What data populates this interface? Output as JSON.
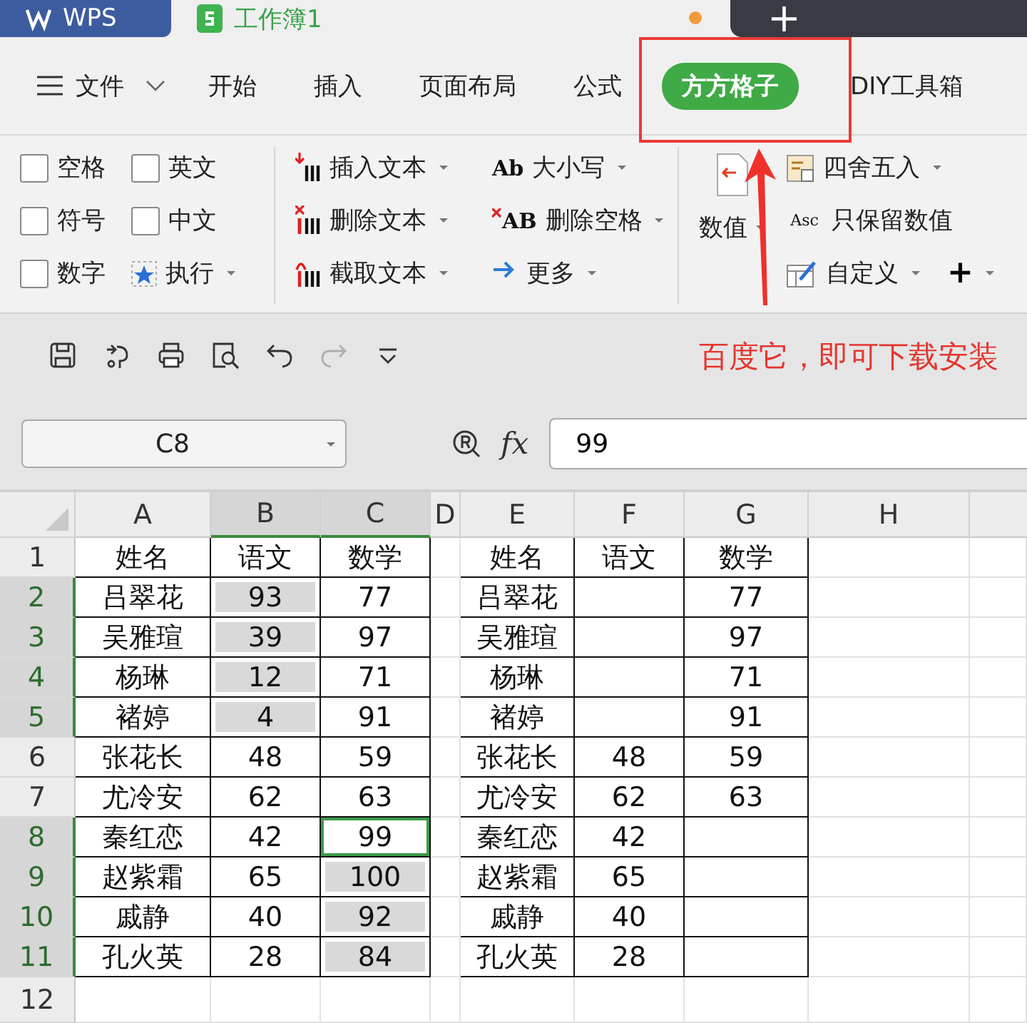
{
  "title_bar": {
    "tabs": [
      {
        "kind": "app",
        "label": "WPS",
        "modified": false
      },
      {
        "kind": "document",
        "label": "工作簿1",
        "modified": true
      }
    ],
    "new_tab": "+"
  },
  "menu": {
    "file": "文件",
    "tabs": [
      {
        "label": "开始",
        "selected": false
      },
      {
        "label": "插入",
        "selected": false
      },
      {
        "label": "页面布局",
        "selected": false
      },
      {
        "label": "公式",
        "selected": false
      },
      {
        "label": "方方格子",
        "selected": true
      },
      {
        "label": "DIY工具箱",
        "selected": false
      }
    ]
  },
  "ribbon": {
    "options": [
      {
        "label": "空格",
        "checked": false
      },
      {
        "label": "英文",
        "checked": false
      },
      {
        "label": "符号",
        "checked": false
      },
      {
        "label": "中文",
        "checked": false
      },
      {
        "label": "数字",
        "checked": false
      }
    ],
    "execute": {
      "label": "执行",
      "dropdown": true
    },
    "text_commands": [
      {
        "kind": "insert",
        "label": "插入文本",
        "dropdown": true
      },
      {
        "kind": "case",
        "glyph": "Ab",
        "label": "大小写",
        "dropdown": true
      },
      {
        "kind": "delete",
        "label": "删除文本",
        "dropdown": true
      },
      {
        "kind": "delete_spaces",
        "glyph": "AB",
        "label": "删除空格",
        "dropdown": true
      },
      {
        "kind": "extract",
        "label": "截取文本",
        "dropdown": true
      },
      {
        "kind": "more",
        "label": "更多",
        "dropdown": true
      }
    ],
    "numbers": {
      "label": "数值",
      "dropdown": true
    },
    "number_commands": [
      {
        "kind": "round",
        "label": "四舍五入",
        "dropdown": true
      },
      {
        "kind": "keep",
        "glyph": "Asc",
        "label": "只保留数值",
        "dropdown": false
      },
      {
        "kind": "custom",
        "label": "自定义",
        "dropdown": true
      }
    ],
    "add": {
      "label": "+",
      "dropdown": true
    }
  },
  "quick_access": [
    {
      "kind": "save",
      "disabled": false
    },
    {
      "kind": "painter",
      "disabled": false
    },
    {
      "kind": "print",
      "disabled": false
    },
    {
      "kind": "preview",
      "disabled": false
    },
    {
      "kind": "undo",
      "disabled": false
    },
    {
      "kind": "redo",
      "disabled": true
    },
    {
      "kind": "customize",
      "disabled": false
    }
  ],
  "annotation": {
    "text": "百度它，即可下载安装"
  },
  "formula_bar": {
    "name_box": "C8",
    "fx": "fx",
    "value": "99"
  },
  "sheet": {
    "columns": [
      {
        "label": "A",
        "selected": false,
        "bordered": true
      },
      {
        "label": "B",
        "selected": true,
        "bordered": true
      },
      {
        "label": "C",
        "selected": true,
        "bordered": true
      },
      {
        "label": "D",
        "selected": false,
        "bordered": false
      },
      {
        "label": "E",
        "selected": false,
        "bordered": true
      },
      {
        "label": "F",
        "selected": false,
        "bordered": true
      },
      {
        "label": "G",
        "selected": false,
        "bordered": true
      },
      {
        "label": "H",
        "selected": false,
        "bordered": false
      }
    ],
    "rows": [
      {
        "number": "1",
        "selected": false,
        "bordered": true,
        "cells": [
          {
            "value": "姓名",
            "selected": false,
            "active": false
          },
          {
            "value": "语文",
            "selected": false,
            "active": false
          },
          {
            "value": "数学",
            "selected": false,
            "active": false
          },
          {
            "selected": false,
            "active": false
          },
          {
            "value": "姓名",
            "selected": false,
            "active": false
          },
          {
            "value": "语文",
            "selected": false,
            "active": false
          },
          {
            "value": "数学",
            "selected": false,
            "active": false
          },
          {
            "selected": false,
            "active": false
          }
        ]
      },
      {
        "number": "2",
        "selected": true,
        "bordered": true,
        "cells": [
          {
            "value": "吕翠花",
            "selected": false,
            "active": false
          },
          {
            "value": "93",
            "selected": true,
            "active": false
          },
          {
            "value": "77",
            "selected": false,
            "active": false
          },
          {
            "selected": false,
            "active": false
          },
          {
            "value": "吕翠花",
            "selected": false,
            "active": false
          },
          {
            "selected": false,
            "active": false
          },
          {
            "value": "77",
            "selected": false,
            "active": false
          },
          {
            "selected": false,
            "active": false
          }
        ]
      },
      {
        "number": "3",
        "selected": true,
        "bordered": true,
        "cells": [
          {
            "value": "吴雅瑄",
            "selected": false,
            "active": false
          },
          {
            "value": "39",
            "selected": true,
            "active": false
          },
          {
            "value": "97",
            "selected": false,
            "active": false
          },
          {
            "selected": false,
            "active": false
          },
          {
            "value": "吴雅瑄",
            "selected": false,
            "active": false
          },
          {
            "selected": false,
            "active": false
          },
          {
            "value": "97",
            "selected": false,
            "active": false
          },
          {
            "selected": false,
            "active": false
          }
        ]
      },
      {
        "number": "4",
        "selected": true,
        "bordered": true,
        "cells": [
          {
            "value": "杨琳",
            "selected": false,
            "active": false
          },
          {
            "value": "12",
            "selected": true,
            "active": false
          },
          {
            "value": "71",
            "selected": false,
            "active": false
          },
          {
            "selected": false,
            "active": false
          },
          {
            "value": "杨琳",
            "selected": false,
            "active": false
          },
          {
            "selected": false,
            "active": false
          },
          {
            "value": "71",
            "selected": false,
            "active": false
          },
          {
            "selected": false,
            "active": false
          }
        ]
      },
      {
        "number": "5",
        "selected": true,
        "bordered": true,
        "cells": [
          {
            "value": "褚婷",
            "selected": false,
            "active": false
          },
          {
            "value": "4",
            "selected": true,
            "active": false
          },
          {
            "value": "91",
            "selected": false,
            "active": false
          },
          {
            "selected": false,
            "active": false
          },
          {
            "value": "褚婷",
            "selected": false,
            "active": false
          },
          {
            "selected": false,
            "active": false
          },
          {
            "value": "91",
            "selected": false,
            "active": false
          },
          {
            "selected": false,
            "active": false
          }
        ]
      },
      {
        "number": "6",
        "selected": false,
        "bordered": true,
        "cells": [
          {
            "value": "张花长",
            "selected": false,
            "active": false
          },
          {
            "value": "48",
            "selected": false,
            "active": false
          },
          {
            "value": "59",
            "selected": false,
            "active": false
          },
          {
            "selected": false,
            "active": false
          },
          {
            "value": "张花长",
            "selected": false,
            "active": false
          },
          {
            "value": "48",
            "selected": false,
            "active": false
          },
          {
            "value": "59",
            "selected": false,
            "active": false
          },
          {
            "selected": false,
            "active": false
          }
        ]
      },
      {
        "number": "7",
        "selected": false,
        "bordered": true,
        "cells": [
          {
            "value": "尤冷安",
            "selected": false,
            "active": false
          },
          {
            "value": "62",
            "selected": false,
            "active": false
          },
          {
            "value": "63",
            "selected": false,
            "active": false
          },
          {
            "selected": false,
            "active": false
          },
          {
            "value": "尤冷安",
            "selected": false,
            "active": false
          },
          {
            "value": "62",
            "selected": false,
            "active": false
          },
          {
            "value": "63",
            "selected": false,
            "active": false
          },
          {
            "selected": false,
            "active": false
          }
        ]
      },
      {
        "number": "8",
        "selected": true,
        "bordered": true,
        "cells": [
          {
            "value": "秦红恋",
            "selected": false,
            "active": false
          },
          {
            "value": "42",
            "selected": false,
            "active": false
          },
          {
            "value": "99",
            "selected": false,
            "active": true
          },
          {
            "selected": false,
            "active": false
          },
          {
            "value": "秦红恋",
            "selected": false,
            "active": false
          },
          {
            "value": "42",
            "selected": false,
            "active": false
          },
          {
            "selected": false,
            "active": false
          },
          {
            "selected": false,
            "active": false
          }
        ]
      },
      {
        "number": "9",
        "selected": true,
        "bordered": true,
        "cells": [
          {
            "value": "赵紫霜",
            "selected": false,
            "active": false
          },
          {
            "value": "65",
            "selected": false,
            "active": false
          },
          {
            "value": "100",
            "selected": true,
            "active": false
          },
          {
            "selected": false,
            "active": false
          },
          {
            "value": "赵紫霜",
            "selected": false,
            "active": false
          },
          {
            "value": "65",
            "selected": false,
            "active": false
          },
          {
            "selected": false,
            "active": false
          },
          {
            "selected": false,
            "active": false
          }
        ]
      },
      {
        "number": "10",
        "selected": true,
        "bordered": true,
        "cells": [
          {
            "value": "戚静",
            "selected": false,
            "active": false
          },
          {
            "value": "40",
            "selected": false,
            "active": false
          },
          {
            "value": "92",
            "selected": true,
            "active": false
          },
          {
            "selected": false,
            "active": false
          },
          {
            "value": "戚静",
            "selected": false,
            "active": false
          },
          {
            "value": "40",
            "selected": false,
            "active": false
          },
          {
            "selected": false,
            "active": false
          },
          {
            "selected": false,
            "active": false
          }
        ]
      },
      {
        "number": "11",
        "selected": true,
        "bordered": true,
        "cells": [
          {
            "value": "孔火英",
            "selected": false,
            "active": false
          },
          {
            "value": "28",
            "selected": false,
            "active": false
          },
          {
            "value": "84",
            "selected": true,
            "active": false
          },
          {
            "selected": false,
            "active": false
          },
          {
            "value": "孔火英",
            "selected": false,
            "active": false
          },
          {
            "value": "28",
            "selected": false,
            "active": false
          },
          {
            "selected": false,
            "active": false
          },
          {
            "selected": false,
            "active": false
          }
        ]
      },
      {
        "number": "12",
        "selected": false,
        "bordered": false,
        "cells": [
          {
            "selected": false,
            "active": false
          },
          {
            "selected": false,
            "active": false
          },
          {
            "selected": false,
            "active": false
          },
          {
            "selected": false,
            "active": false
          },
          {
            "selected": false,
            "active": false
          },
          {
            "selected": false,
            "active": false
          },
          {
            "selected": false,
            "active": false
          },
          {
            "selected": false,
            "active": false
          }
        ]
      }
    ]
  }
}
